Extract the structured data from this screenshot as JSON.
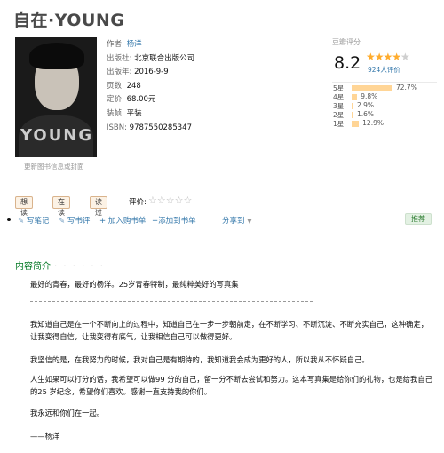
{
  "book": {
    "title": "自在·YOUNG",
    "cover_brand": "YOUNG",
    "cover_link": "更新图书信息或封面"
  },
  "info": {
    "author_label": "作者:",
    "author": "杨洋",
    "publisher_label": "出版社:",
    "publisher": "北京联合出版公司",
    "pubdate_label": "出版年:",
    "pubdate": "2016-9-9",
    "pages_label": "页数:",
    "pages": "248",
    "price_label": "定价:",
    "price": "68.00元",
    "binding_label": "装帧:",
    "binding": "平装",
    "isbn_label": "ISBN:",
    "isbn": "9787550285347"
  },
  "rating": {
    "heading": "豆瓣评分",
    "score": "8.2",
    "stars_on": "★★★★",
    "stars_off": "★",
    "people": "924人评价",
    "distribution": [
      {
        "label": "5星",
        "percent": 72.7,
        "text": "72.7%"
      },
      {
        "label": "4星",
        "percent": 9.8,
        "text": "9.8%"
      },
      {
        "label": "3星",
        "percent": 2.9,
        "text": "2.9%"
      },
      {
        "label": "2星",
        "percent": 1.6,
        "text": "1.6%"
      },
      {
        "label": "1星",
        "percent": 12.9,
        "text": "12.9%"
      }
    ],
    "bar_color": "#ffd596"
  },
  "actions": {
    "want": "想读",
    "reading": "在读",
    "read": "读过",
    "rate_label": "评价:",
    "rate_stars": "☆☆☆☆☆"
  },
  "ops": {
    "write_note": "写笔记",
    "write_review": "写书评",
    "add_cart": "加入购书单",
    "add_list": "添加到书单",
    "share": "分享到",
    "recommend": "推荐"
  },
  "intro": {
    "title": "内容简介",
    "dots": "· · · · · ·",
    "p1": "最好的青春，最好的杨洋。25岁青春特制，最纯粹美好的写真集",
    "p2": "我知道自己是在一个不断向上的过程中，知道自己在一步一步朝前走，在不断学习、不断沉淀、不断充实自己，这种确定，让我变得自信，让我变得有底气，让我相信自己可以做得更好。",
    "p3": "我坚信的是，在我努力的时候，我对自己是有期待的，我知道我会成为更好的人，所以我从不怀疑自己。",
    "p4": "人生如果可以打分的话，我希望可以做99 分的自己，留一分不断去尝试和努力。这本写真集是给你们的礼物，也是给我自己的25 岁纪念，希望你们喜欢。感谢一直支持我的你们。",
    "p5": "我永远和你们在一起。",
    "p6": "——杨洋"
  },
  "colors": {
    "link": "#3377aa",
    "section_title": "#007722",
    "star": "#ffac2d"
  }
}
